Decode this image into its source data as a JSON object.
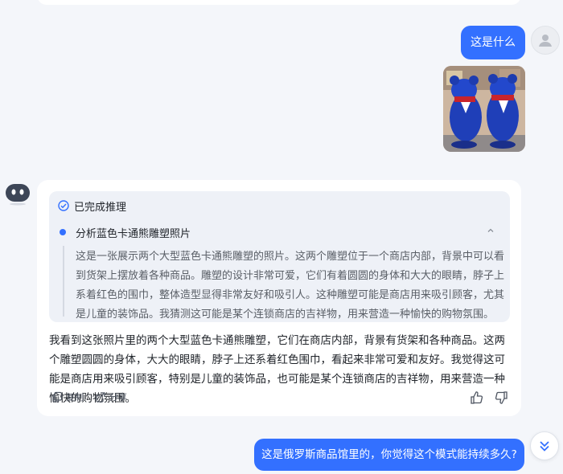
{
  "messages": {
    "user_1": {
      "text": "这是什么"
    },
    "bot": {
      "reasoning": {
        "status": "已完成推理",
        "step_title": "分析蓝色卡通熊雕塑照片",
        "text": "这是一张展示两个大型蓝色卡通熊雕塑的照片。这两个雕塑位于一个商店内部，背景中可以看到货架上摆放着各种商品。雕塑的设计非常可爱，它们有着圆圆的身体和大大的眼睛，脖子上系着红色的围巾，整体造型显得非常友好和吸引人。这种雕塑可能是商店用来吸引顾客，尤其是儿童的装饰品。我猜测这可能是某个连锁商店的吉祥物，用来营造一种愉快的购物氛围。"
      },
      "answer": "我看到这张照片里的两个大型蓝色卡通熊雕塑，它们在商店内部，背景有货架和各种商品。这两个雕塑圆圆的身体，大大的眼睛，脖子上还系着红色围巾，看起来非常可爱和友好。我觉得这可能是商店用来吸引顾客，特别是儿童的装饰品，也可能是某个连锁商店的吉祥物，用来营造一种愉快的购物氛围。",
      "actions": {
        "copy": "复制",
        "share": "分享"
      }
    },
    "user_2": {
      "text": "这是俄罗斯商品馆里的，你觉得这个模式能持续多久?"
    }
  },
  "colors": {
    "accent": "#3370ff",
    "page_bg": "#f4f6fa",
    "card_bg": "#ffffff",
    "reason_bg": "#eef1f7"
  },
  "icons": [
    "user-avatar-icon",
    "bot-avatar-icon",
    "check-circle-icon",
    "chevron-up-icon",
    "copy-icon",
    "share-icon",
    "thumbs-up-icon",
    "thumbs-down-icon",
    "scroll-down-icon"
  ]
}
